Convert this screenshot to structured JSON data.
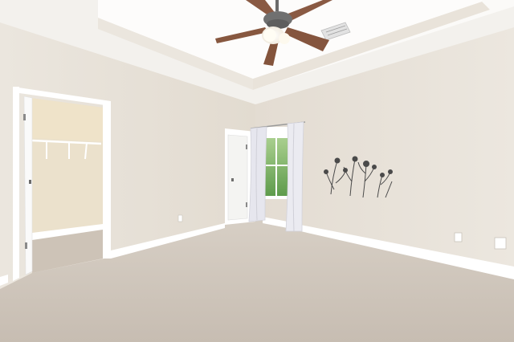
{
  "scene": {
    "kind": "photo",
    "colors": {
      "ceiling": "#f6f4f1",
      "tray_ceiling": "#fbfaf8",
      "left_wall": "#ebe5dc",
      "right_wall": "#e7e1d8",
      "back_wall": "#e4ddd3",
      "carpet": "#cfc6bb",
      "trim": "#ffffff",
      "closet_wall": "#ece2cf",
      "window_glass": "#7fb06a",
      "curtain": "#e9e9ef",
      "fan_blade": "#8a5a43",
      "fan_body": "#6b6b6b",
      "fan_light": "#fffdf4",
      "decal": "#4a4a4a",
      "vent": "#d8d8d8"
    },
    "icons": {
      "ceiling_fan": "ceiling-fan-icon",
      "wall_decal": "botanical-wall-decal",
      "outlet": "outlet-icon"
    }
  }
}
